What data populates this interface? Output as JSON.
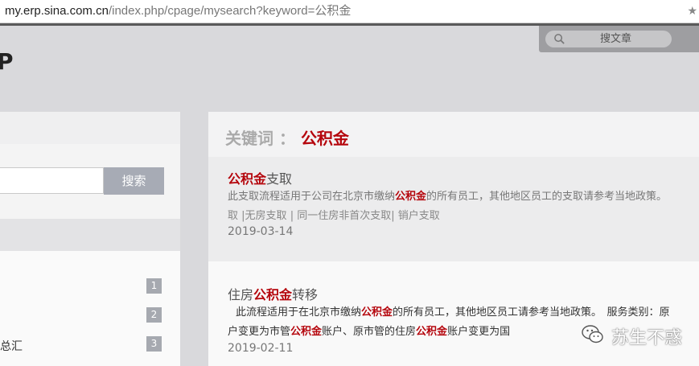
{
  "address_bar": {
    "host": "my.erp.sina.com.cn",
    "path": "/index.php/cpage/mysearch?keyword=公积金",
    "star_icon": "star-icon"
  },
  "header": {
    "logo_fragment": "P",
    "search_placeholder": "搜文章",
    "search_icon": "magnifier-icon"
  },
  "left_panel": {
    "search_button_label": "搜索",
    "list_numbers": [
      "1",
      "2",
      "3"
    ],
    "list_item_text": "总汇"
  },
  "main": {
    "keyword_label": "关键词",
    "keyword_separator": "：",
    "keyword_value": "公积金",
    "results": [
      {
        "title_hl": "公积金",
        "title_rest": "支取",
        "desc_pre": "此支取流程适用于公司在北京市缴纳",
        "desc_hl": "公积金",
        "desc_post": "的所有员工，其他地区员工的支取请参考当地政策。",
        "tags": [
          "取",
          "|无房支取",
          "|",
          "同一住房非首次支取",
          "|",
          "销户支取"
        ],
        "date": "2019-03-14"
      },
      {
        "title_pre": "住房",
        "title_hl": "公积金",
        "title_rest": "转移",
        "desc_pre": "此流程适用于在北京市缴纳",
        "desc_hl": "公积金",
        "desc_post": "的所有员工，其他地区员工请参考当地政策。　服务类别：原",
        "line2_pre": "户变更为市管",
        "line2_hl1": "公积金",
        "line2_mid": "账户、原市管的住房",
        "line2_hl2": "公积金",
        "line2_post": "账户变更为国",
        "date": "2019-02-11"
      }
    ]
  },
  "watermark": {
    "text": "苏生不惑",
    "icon": "wechat-icon"
  },
  "colors": {
    "highlight": "#b5060d",
    "button_bg": "#a7abb5",
    "page_bg": "#d9d9dc"
  }
}
